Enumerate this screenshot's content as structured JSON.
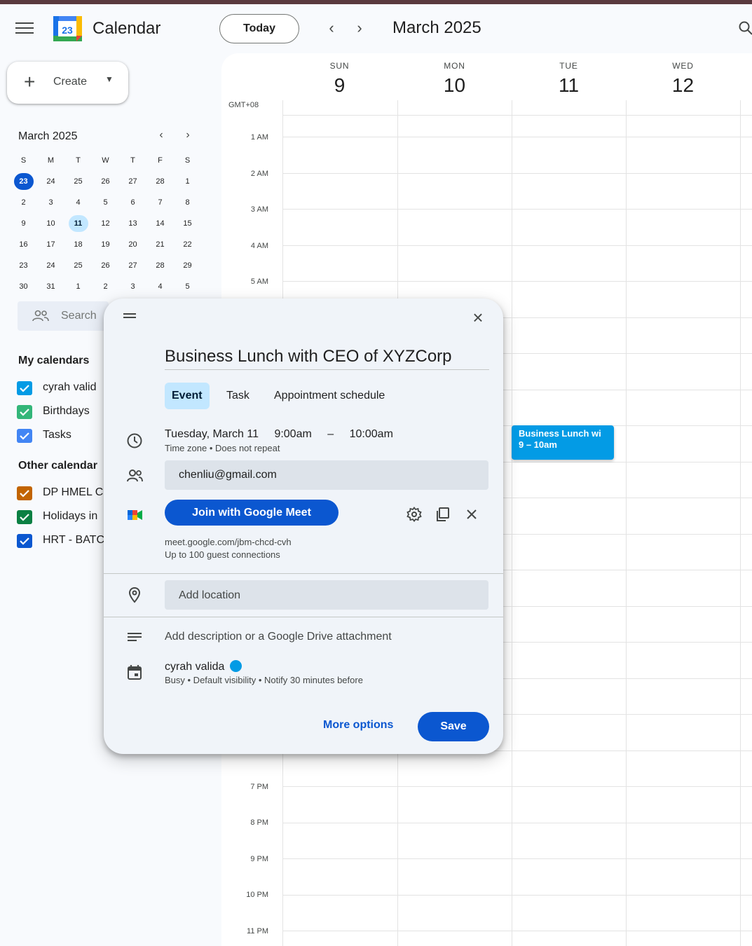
{
  "header": {
    "app_title": "Calendar",
    "logo_day": "23",
    "today_label": "Today",
    "month_title": "March 2025"
  },
  "sidebar": {
    "create_label": "Create",
    "mini_calendar": {
      "title": "March 2025",
      "weekdays": [
        "S",
        "M",
        "T",
        "W",
        "T",
        "F",
        "S"
      ],
      "weeks": [
        [
          "23",
          "24",
          "25",
          "26",
          "27",
          "28",
          "1"
        ],
        [
          "2",
          "3",
          "4",
          "5",
          "6",
          "7",
          "8"
        ],
        [
          "9",
          "10",
          "11",
          "12",
          "13",
          "14",
          "15"
        ],
        [
          "16",
          "17",
          "18",
          "19",
          "20",
          "21",
          "22"
        ],
        [
          "23",
          "24",
          "25",
          "26",
          "27",
          "28",
          "29"
        ],
        [
          "30",
          "31",
          "1",
          "2",
          "3",
          "4",
          "5"
        ]
      ]
    },
    "search_placeholder": "Search",
    "my_calendars_title": "My calendars",
    "my_calendars": [
      {
        "label": "cyrah valid",
        "color": "#039be5"
      },
      {
        "label": "Birthdays",
        "color": "#33b679"
      },
      {
        "label": "Tasks",
        "color": "#4285f4"
      }
    ],
    "other_calendars_title": "Other calendar",
    "other_calendars": [
      {
        "label": "DP HMEL C",
        "color": "#c26401"
      },
      {
        "label": "Holidays in",
        "color": "#0b8043"
      },
      {
        "label": "HRT - BATC",
        "color": "#0b57d0"
      }
    ]
  },
  "grid": {
    "timezone": "GMT+08",
    "days": [
      {
        "dow": "SUN",
        "num": "9"
      },
      {
        "dow": "MON",
        "num": "10"
      },
      {
        "dow": "TUE",
        "num": "11"
      },
      {
        "dow": "WED",
        "num": "12"
      }
    ],
    "hours_top": [
      "1 AM",
      "2 AM",
      "3 AM",
      "4 AM",
      "5 AM"
    ],
    "hours_bottom": [
      "7 PM",
      "8 PM",
      "9 PM",
      "10 PM",
      "11 PM"
    ],
    "event": {
      "title": "Business Lunch wi",
      "time": "9 – 10am"
    }
  },
  "dialog": {
    "title": "Business Lunch with CEO of XYZCorp",
    "tabs": [
      "Event",
      "Task",
      "Appointment schedule"
    ],
    "date": "Tuesday, March 11",
    "start": "9:00am",
    "dash": "–",
    "end": "10:00am",
    "tz_repeat": "Time zone • Does not repeat",
    "guest": "chenliu@gmail.com",
    "meet_label": "Join with Google Meet",
    "meet_link": "meet.google.com/jbm-chcd-cvh",
    "meet_limit": "Up to 100 guest connections",
    "location_placeholder": "Add location",
    "description_placeholder": "Add description or a Google Drive attachment",
    "owner": "cyrah valida",
    "owner_color": "#039be5",
    "owner_details": "Busy • Default visibility • Notify 30 minutes before",
    "more_options": "More options",
    "save": "Save"
  },
  "colors": {
    "primary": "#0b57d0",
    "event": "#039be5",
    "selected_tab": "#c2e7ff"
  }
}
